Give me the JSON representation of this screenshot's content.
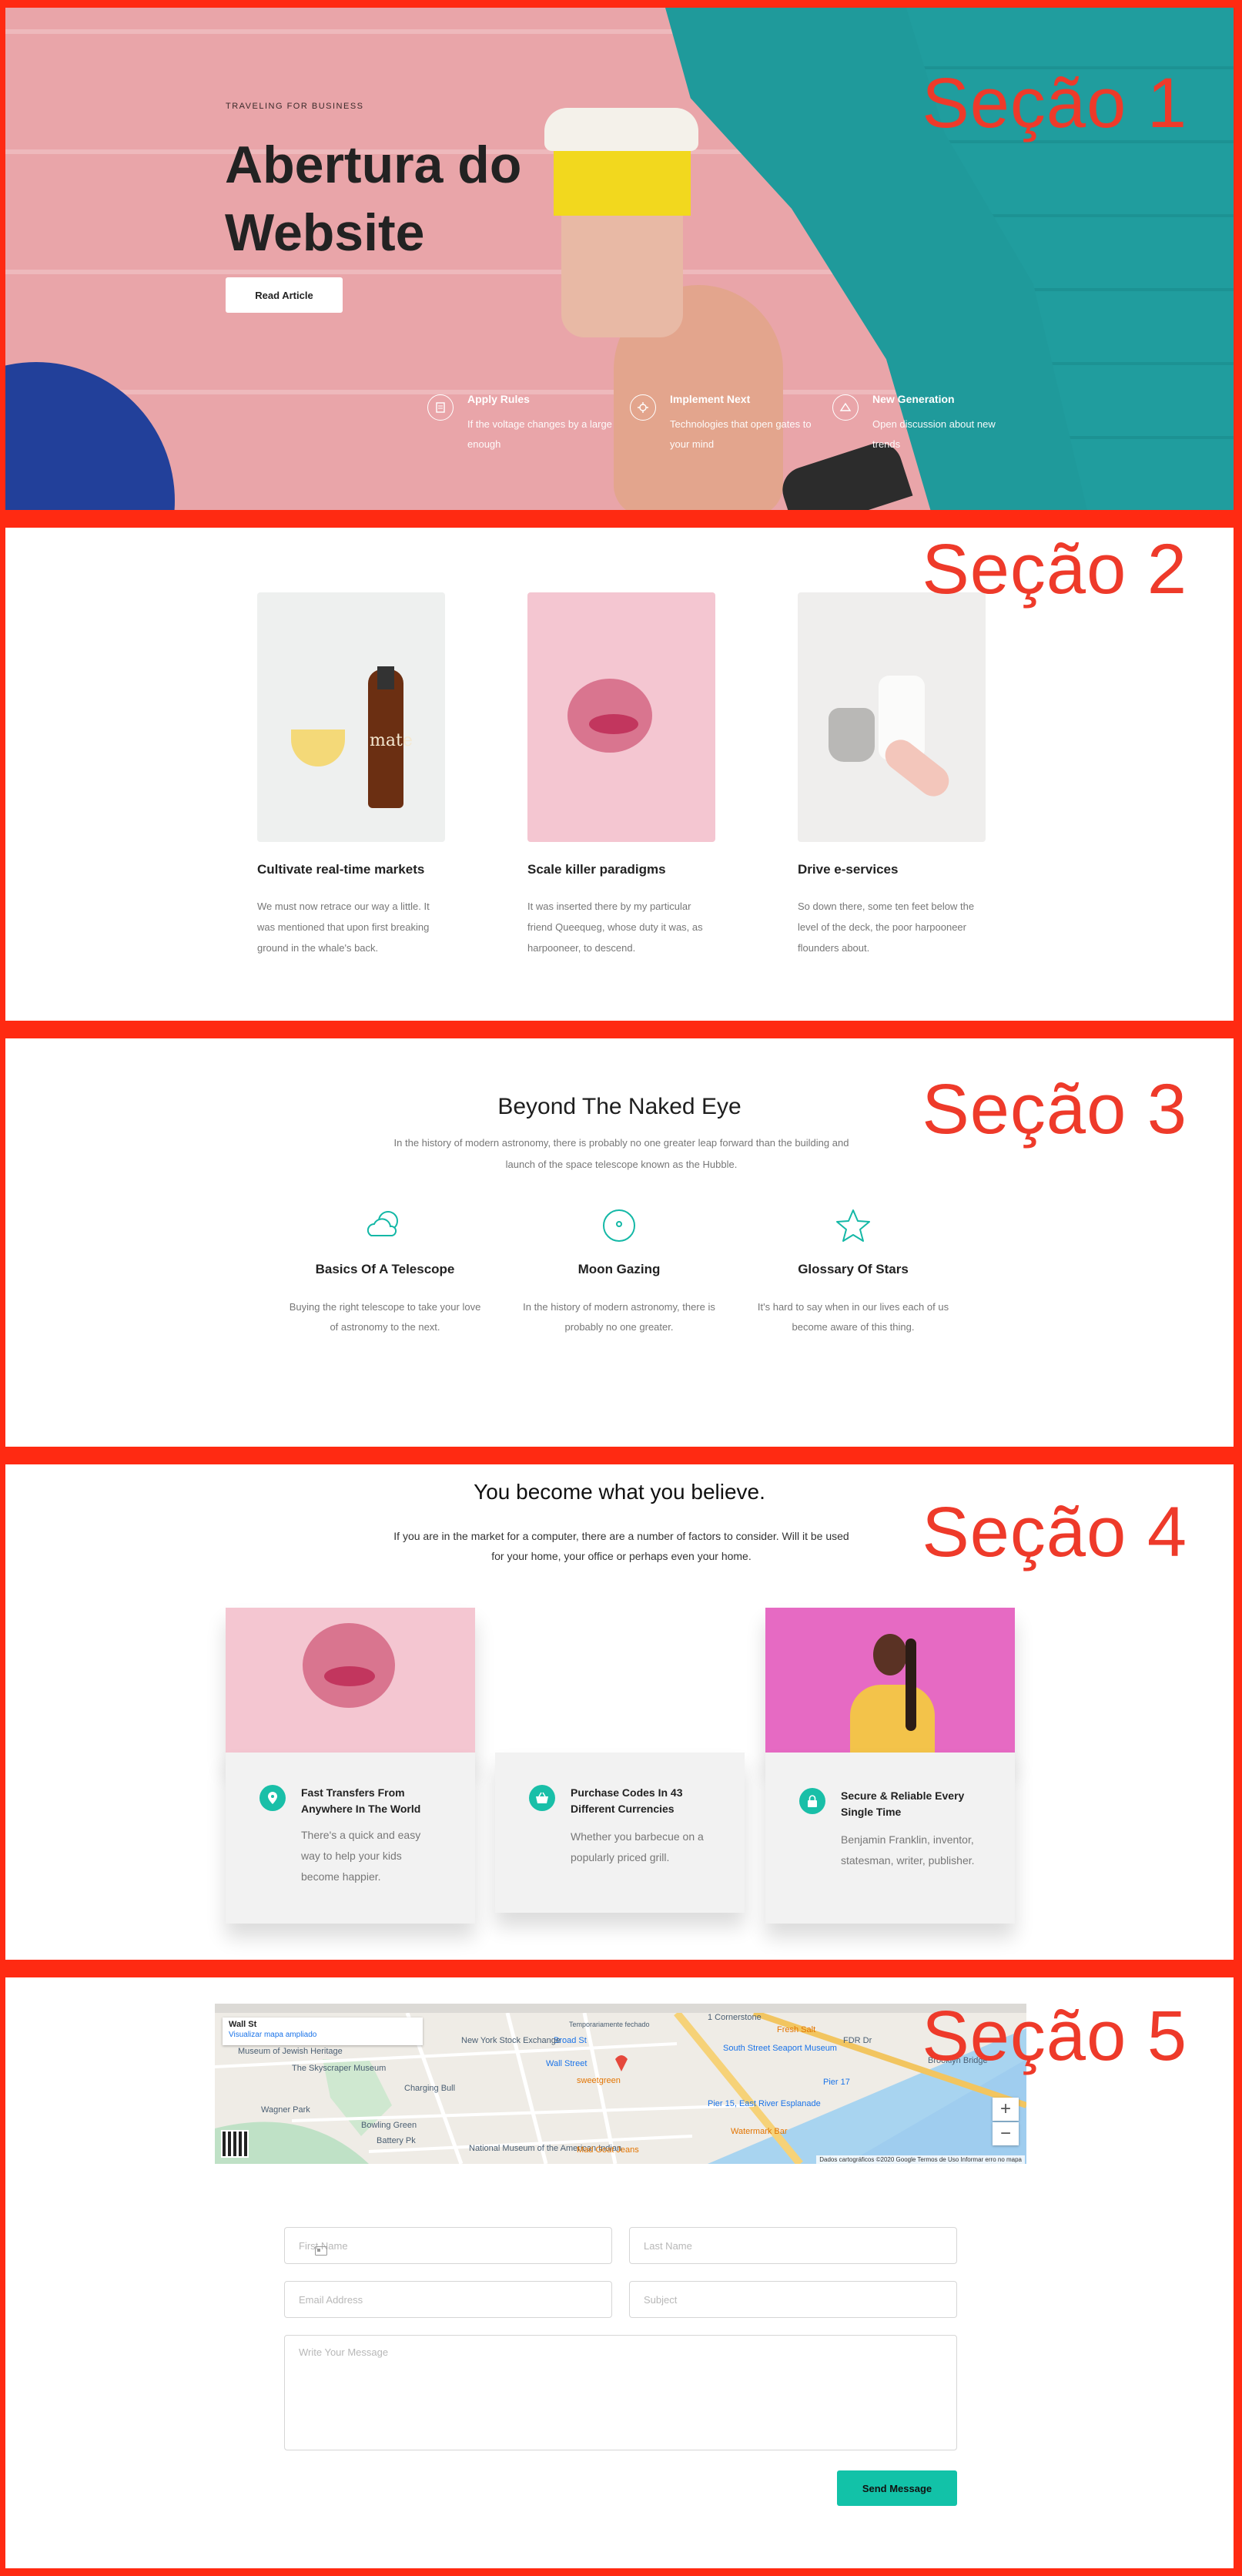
{
  "section_labels": [
    "Seção 1",
    "Seção 2",
    "Seção 3",
    "Seção 4",
    "Seção 5"
  ],
  "hero": {
    "eyebrow": "TRAVELING FOR BUSINESS",
    "title": "Abertura do Website",
    "button": "Read Article",
    "features": [
      {
        "icon": "rules-icon",
        "title": "Apply Rules",
        "desc": "If the voltage changes by a large enough"
      },
      {
        "icon": "implement-icon",
        "title": "Implement Next",
        "desc": "Technologies that open gates to your mind"
      },
      {
        "icon": "generation-icon",
        "title": "New Generation",
        "desc": "Open discussion about new trends"
      }
    ]
  },
  "cards": [
    {
      "title": "Cultivate real-time markets",
      "desc": "We must now retrace our way a little. It was mentioned that upon first breaking ground in the whale's back.",
      "bottle_label": "mate"
    },
    {
      "title": "Scale killer paradigms",
      "desc": "It was inserted there by my particular friend Queequeg, whose duty it was, as harpooneer, to descend."
    },
    {
      "title": "Drive e-services",
      "desc": "So down there, some ten feet below the level of the deck, the poor harpooneer flounders about."
    }
  ],
  "astronomy": {
    "title": "Beyond The Naked Eye",
    "subtitle": "In the history of modern astronomy, there is probably no one greater leap forward than the building and launch of the space telescope known as the Hubble.",
    "features": [
      {
        "title": "Basics Of A Telescope",
        "desc": "Buying the right telescope to take your love of astronomy to the next."
      },
      {
        "title": "Moon Gazing",
        "desc": "In the history of modern astronomy, there is probably no one greater."
      },
      {
        "title": "Glossary Of Stars",
        "desc": "It's hard to say when in our lives each of us become aware of this thing."
      }
    ]
  },
  "believe": {
    "title": "You become what you believe.",
    "subtitle": "If you are in the market for a computer, there are a number of factors to consider. Will it be used for your home, your office or perhaps even your home.",
    "cards": [
      {
        "title": "Fast Transfers From Anywhere In The World",
        "desc": "There's a quick and easy way to help your kids become happier."
      },
      {
        "title": "Purchase Codes In 43 Different Currencies",
        "desc": "Whether you barbecue on a popularly priced grill."
      },
      {
        "title": "Secure & Reliable Every Single Time",
        "desc": "Benjamin Franklin, inventor, statesman, writer, publisher."
      }
    ]
  },
  "map": {
    "place": "Wall St",
    "link": "Visualizar mapa ampliado",
    "labels": [
      "The Skyscraper Museum",
      "Charging Bull",
      "Bowling Green",
      "Wagner Park",
      "Battery Pk",
      "Wall Street",
      "Broad St",
      "Temporariamente fechado",
      "sweetgreen",
      "South Street Seaport Museum",
      "Fresh Salt",
      "Pier 17",
      "Pier 15, East River Esplanade",
      "Watermark Bar",
      "Brooklyn Bridge",
      "National Museum of the American Indian",
      "Mad Goat Jeans",
      "Museum of Jewish Heritage",
      "FDR Dr",
      "New York Stock Exchange",
      "1 Cornerstone"
    ],
    "footer": "Dados cartográficos ©2020 Google   Termos de Uso   Informar erro no mapa",
    "zoom_in": "+",
    "zoom_out": "−"
  },
  "form": {
    "first_name": "First Name",
    "last_name": "Last Name",
    "email": "Email Address",
    "subject": "Subject",
    "message": "Write Your Message",
    "submit": "Send Message"
  },
  "colors": {
    "accent": "#12c2a8",
    "frame": "#ff2a12",
    "label": "#ee3a2a"
  }
}
